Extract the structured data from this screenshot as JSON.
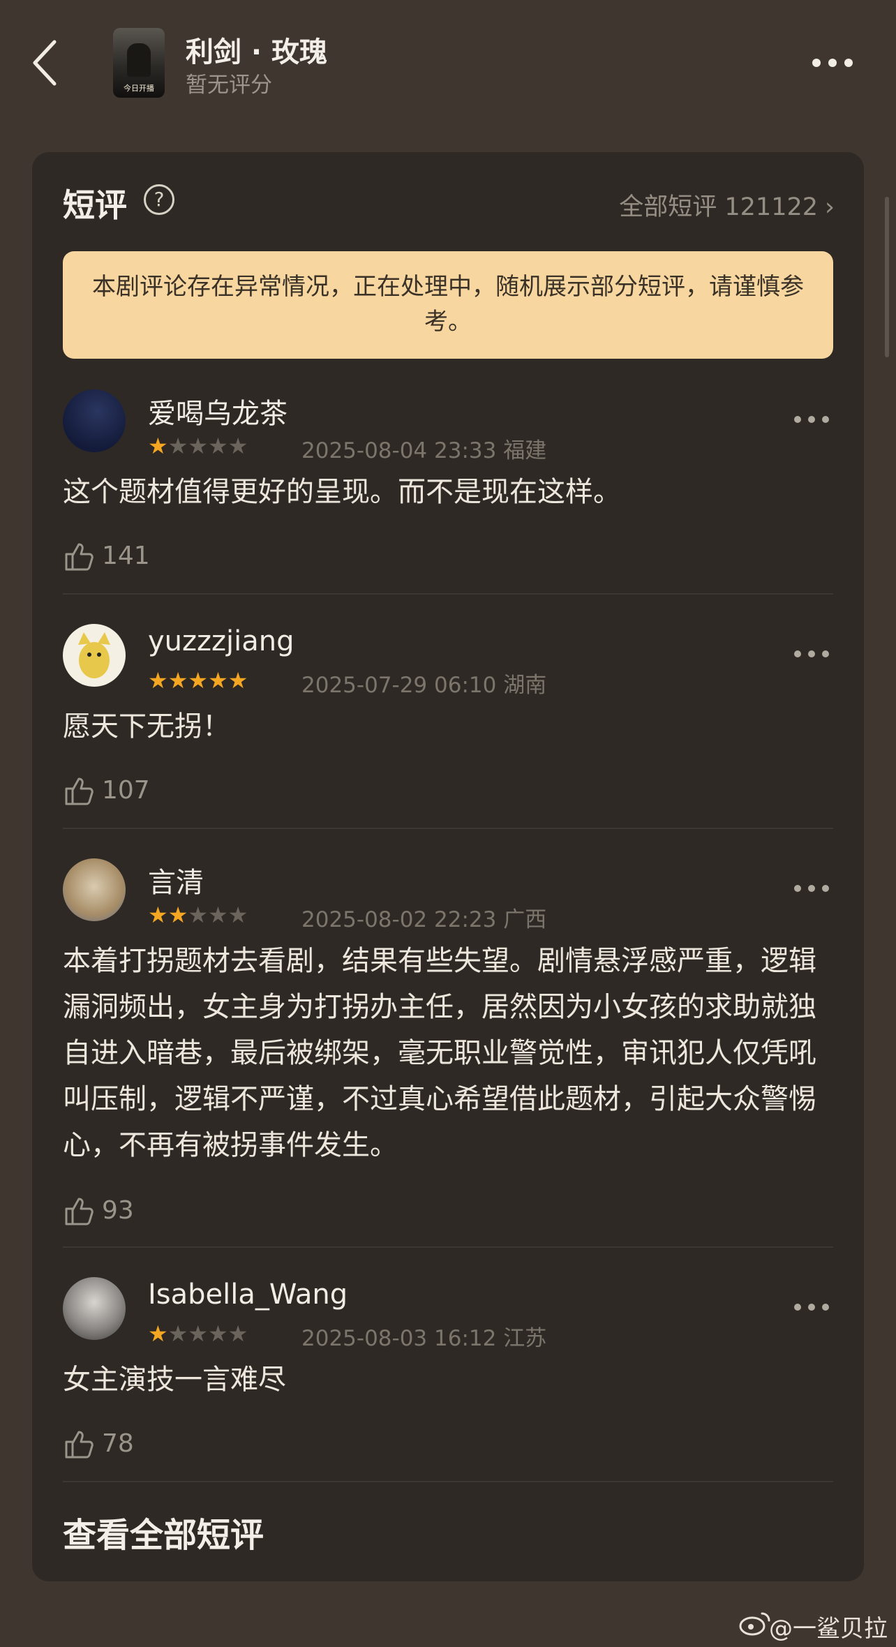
{
  "header": {
    "title": "利剑 · 玫瑰",
    "subtitle": "暂无评分",
    "poster_text": "今日开播"
  },
  "section": {
    "title": "短评",
    "all_reviews_label": "全部短评 121122",
    "notice": "本剧评论存在异常情况，正在处理中，随机展示部分短评，请谨慎参考。"
  },
  "reviews": [
    {
      "username": "爱喝乌龙茶",
      "rating": 1,
      "datetime": "2025-08-04 23:33",
      "location": "福建",
      "text": "这个题材值得更好的呈现。而不是现在这样。",
      "likes": "141"
    },
    {
      "username": "yuzzzjiang",
      "rating": 5,
      "datetime": "2025-07-29 06:10",
      "location": "湖南",
      "text": "愿天下无拐！",
      "likes": "107"
    },
    {
      "username": "言清",
      "rating": 2,
      "datetime": "2025-08-02 22:23",
      "location": "广西",
      "text": "本着打拐题材去看剧，结果有些失望。剧情悬浮感严重，逻辑漏洞频出，女主身为打拐办主任，居然因为小女孩的求助就独自进入暗巷，最后被绑架，毫无职业警觉性，审讯犯人仅凭吼叫压制，逻辑不严谨，不过真心希望借此题材，引起大众警惕心，不再有被拐事件发生。",
      "likes": "93"
    },
    {
      "username": "Isabella_Wang",
      "rating": 1,
      "datetime": "2025-08-03 16:12",
      "location": "江苏",
      "text": "女主演技一言难尽",
      "likes": "78"
    }
  ],
  "footer": {
    "view_all_label": "查看全部短评"
  },
  "watermark": "@一鲨贝拉",
  "colors": {
    "star": "#f5a623",
    "notice_bg": "#f7d6a0",
    "card_bg": "#2e2924",
    "page_bg": "#3e362f"
  }
}
